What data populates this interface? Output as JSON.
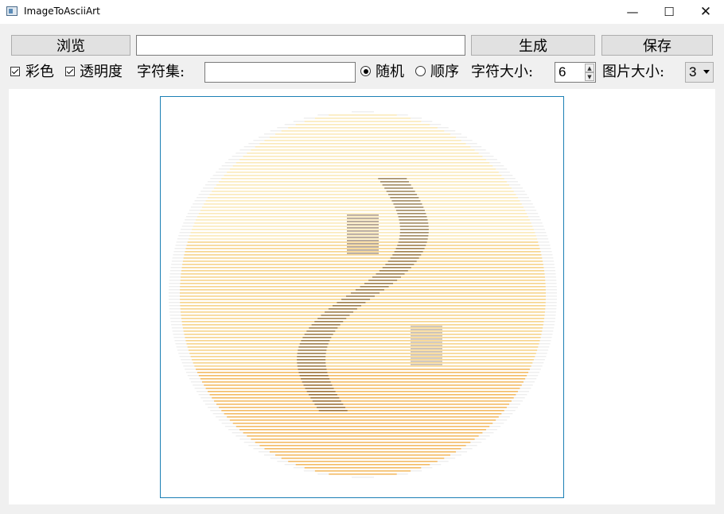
{
  "window": {
    "title": "ImageToAsciiArt",
    "minimize_glyph": "—",
    "maximize_glyph": "☐",
    "close_glyph": "✕"
  },
  "toolbar": {
    "browse_label": "浏览",
    "path_value": "",
    "generate_label": "生成",
    "save_label": "保存"
  },
  "options": {
    "color_label": "彩色",
    "color_checked": true,
    "transparency_label": "透明度",
    "transparency_checked": true,
    "charset_label": "字符集:",
    "charset_value": "",
    "random_label": "随机",
    "random_selected": true,
    "sequential_label": "顺序",
    "sequential_selected": false,
    "char_size_label": "字符大小:",
    "char_size_value": "6",
    "image_size_label": "图片大小:",
    "image_size_value": "3"
  },
  "preview": {
    "icon": "ascii-art-preview-image",
    "base_color": "#fde9b0",
    "shade_color": "#f3b24c",
    "dark_color": "#5a3a1a"
  }
}
